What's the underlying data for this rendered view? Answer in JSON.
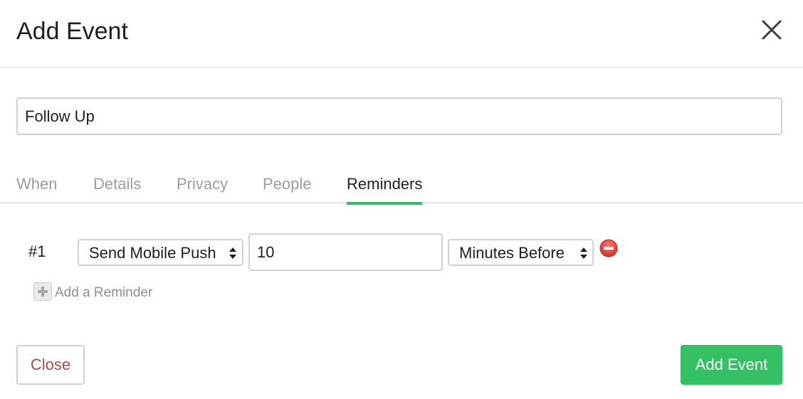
{
  "header": {
    "title": "Add Event",
    "close_icon": "close-icon"
  },
  "event": {
    "title_value": "Follow Up"
  },
  "tabs": [
    {
      "label": "When",
      "active": false
    },
    {
      "label": "Details",
      "active": false
    },
    {
      "label": "Privacy",
      "active": false
    },
    {
      "label": "People",
      "active": false
    },
    {
      "label": "Reminders",
      "active": true
    }
  ],
  "reminders": [
    {
      "number": "#1",
      "method": "Send Mobile Push",
      "amount": "10",
      "timing": "Minutes Before"
    }
  ],
  "add_reminder_label": "Add a Reminder",
  "footer": {
    "close_label": "Close",
    "submit_label": "Add Event"
  },
  "colors": {
    "accent_green": "#35c066",
    "tab_underline": "#37b86b",
    "close_text": "#b04a4a",
    "remove_red": "#e0443c"
  }
}
